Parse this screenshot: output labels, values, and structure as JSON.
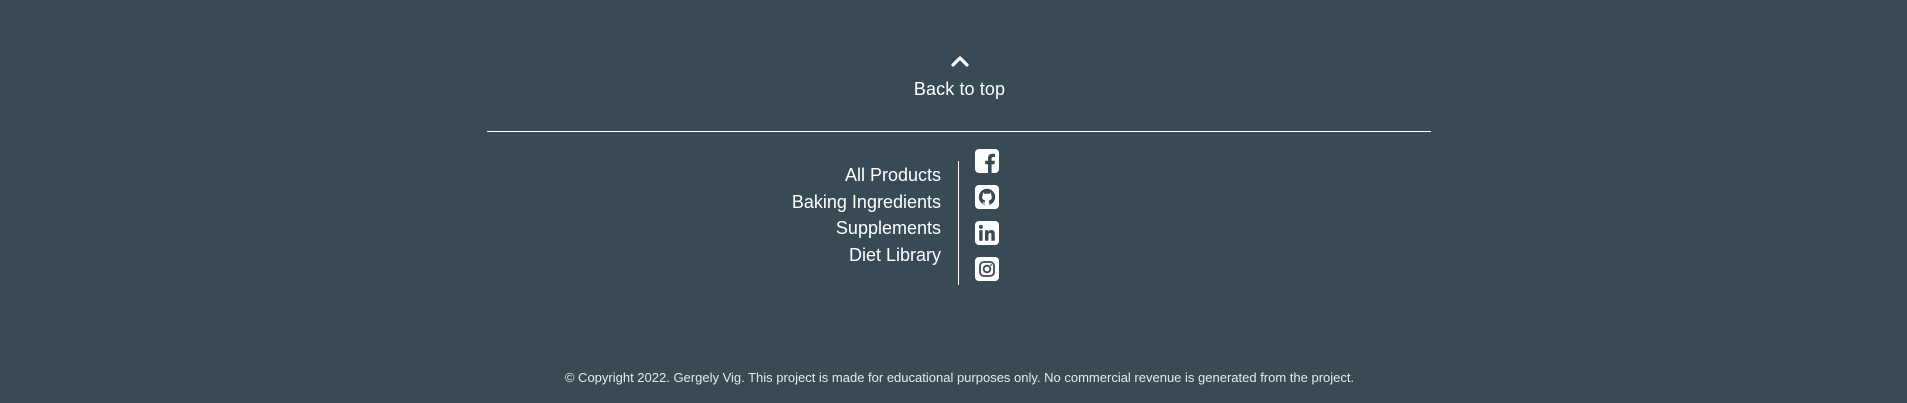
{
  "footer": {
    "back_to_top": {
      "icon": "chevron-up-icon",
      "label": "Back to top"
    },
    "nav_links": [
      {
        "label": "All Products"
      },
      {
        "label": "Baking Ingredients"
      },
      {
        "label": "Supplements"
      },
      {
        "label": "Diet Library"
      }
    ],
    "social_icons": [
      {
        "icon": "facebook-icon"
      },
      {
        "icon": "github-icon"
      },
      {
        "icon": "linkedin-icon"
      },
      {
        "icon": "instagram-icon"
      }
    ],
    "copyright": "© Copyright 2022. Gergely Vig. This project is made for educational purposes only. No commercial revenue is generated from the project."
  },
  "colors": {
    "background": "#384a54",
    "text": "#ffffff"
  }
}
